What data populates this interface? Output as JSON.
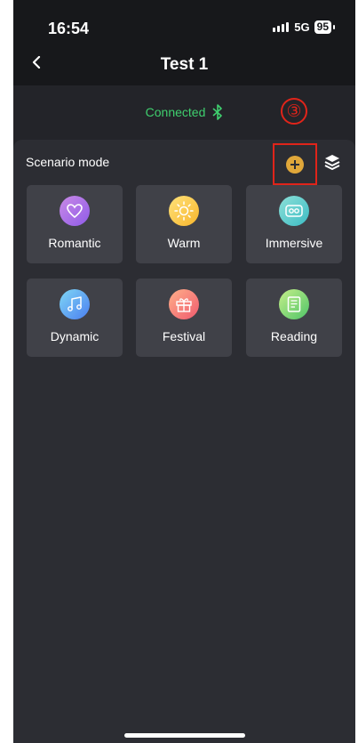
{
  "status": {
    "time": "16:54",
    "network": "5G",
    "battery": "95"
  },
  "header": {
    "title": "Test 1",
    "back_icon": "chevron-left-icon"
  },
  "connection": {
    "status": "Connected",
    "icon": "bluetooth-icon",
    "color": "#3fcf6e"
  },
  "annotation": {
    "marker": "③",
    "color": "#e0241a"
  },
  "scenario": {
    "title": "Scenario mode",
    "add_icon": "add-circle-icon",
    "layers_icon": "layers-icon",
    "modes": [
      {
        "label": "Romantic",
        "icon": "heart-icon",
        "gradient": [
          "#c98ae6",
          "#8f5be8"
        ]
      },
      {
        "label": "Warm",
        "icon": "sun-icon",
        "gradient": [
          "#ffe27a",
          "#f7b52c"
        ]
      },
      {
        "label": "Immersive",
        "icon": "vr-goggles-icon",
        "gradient": [
          "#8de0d8",
          "#3cbcc4"
        ]
      },
      {
        "label": "Dynamic",
        "icon": "music-note-icon",
        "gradient": [
          "#7fd7f5",
          "#4b7ef0"
        ]
      },
      {
        "label": "Festival",
        "icon": "gift-icon",
        "gradient": [
          "#ffb08a",
          "#ef5a6e"
        ]
      },
      {
        "label": "Reading",
        "icon": "document-icon",
        "gradient": [
          "#c6ef8a",
          "#4fc468"
        ]
      }
    ]
  },
  "colors": {
    "background": "#232429",
    "panel": "#2c2d33",
    "card": "#404148",
    "accent": "#e0a73a"
  }
}
